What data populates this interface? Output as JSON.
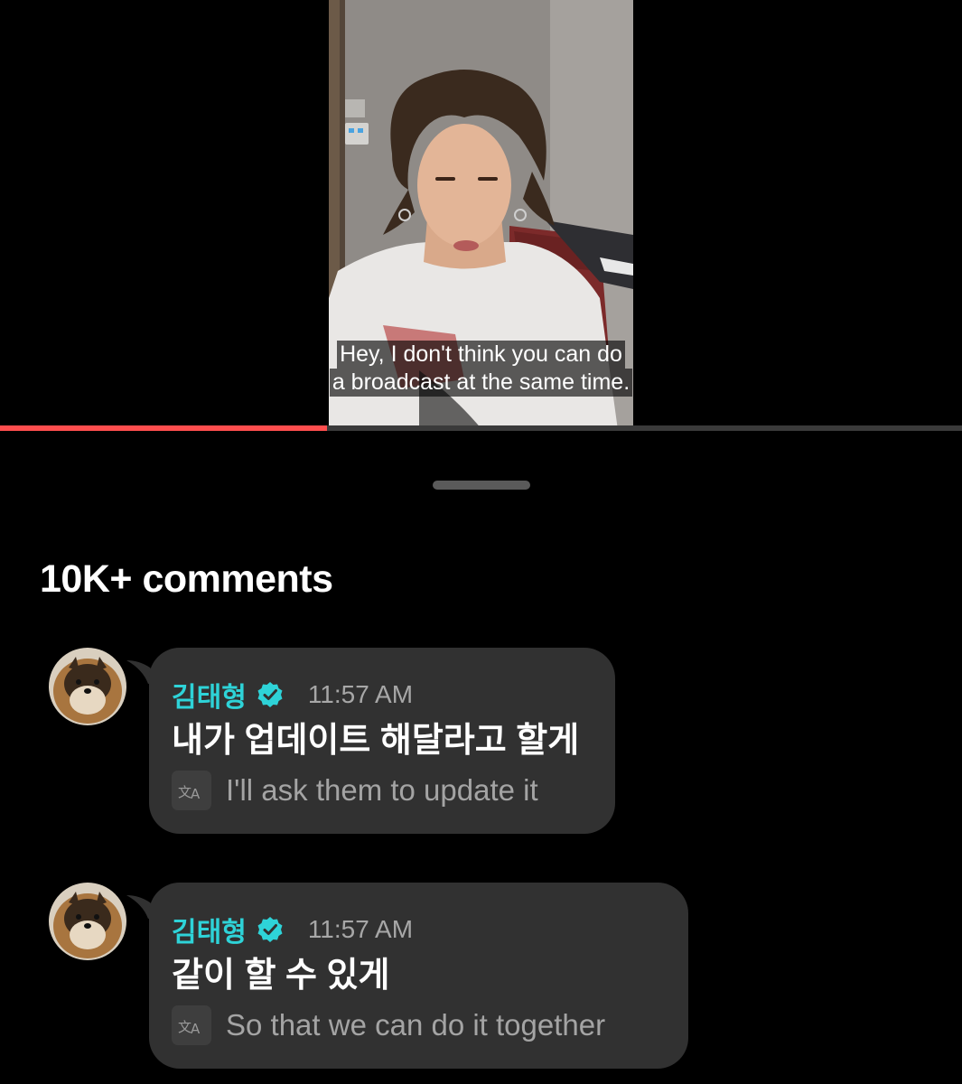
{
  "video": {
    "subtitle_lines": [
      "Hey, I don't think you can do",
      "a broadcast at the same time."
    ],
    "progress_fraction": 0.34
  },
  "sheet": {
    "heading": "10K+ comments"
  },
  "comments": [
    {
      "author": "김태형",
      "time": "11:57 AM",
      "text": "내가 업데이트 해달라고 할게",
      "translation": "I'll ask them to update it"
    },
    {
      "author": "김태형",
      "time": "11:57 AM",
      "text": "같이 할 수 있게",
      "translation": "So that we can do it together"
    }
  ],
  "colors": {
    "accent_progress": "#ff4e4e",
    "author_name": "#2ed3d8",
    "verified_badge": "#2ed3d8",
    "bubble_bg": "#313131"
  },
  "icons": {
    "verified": "verified-badge-icon",
    "translate": "translate-icon"
  }
}
